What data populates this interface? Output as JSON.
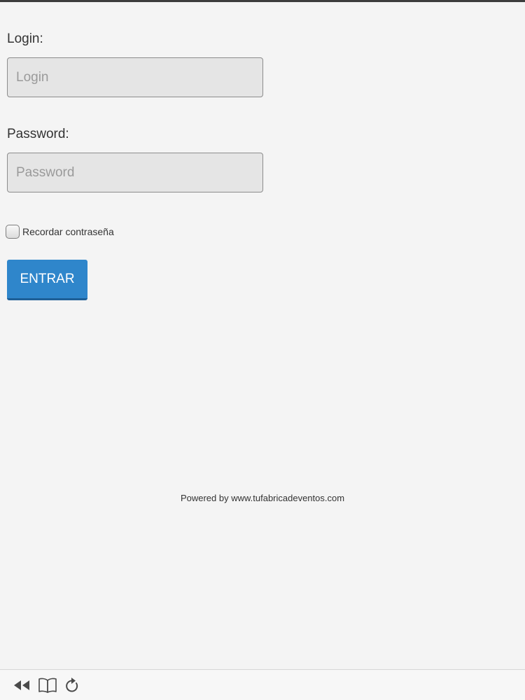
{
  "login": {
    "label": "Login:",
    "placeholder": "Login",
    "value": ""
  },
  "password": {
    "label": "Password:",
    "placeholder": "Password",
    "value": ""
  },
  "remember": {
    "label": "Recordar contraseña",
    "checked": false
  },
  "submit": {
    "label": "ENTRAR"
  },
  "footer": {
    "text": "Powered by www.tufabricadeventos.com"
  },
  "toolbar": {
    "icons": [
      "rewind-icon",
      "book-icon",
      "reload-icon"
    ]
  },
  "colors": {
    "accent": "#2f86cb",
    "background": "#f4f4f4",
    "input_background": "#e5e5e5"
  }
}
